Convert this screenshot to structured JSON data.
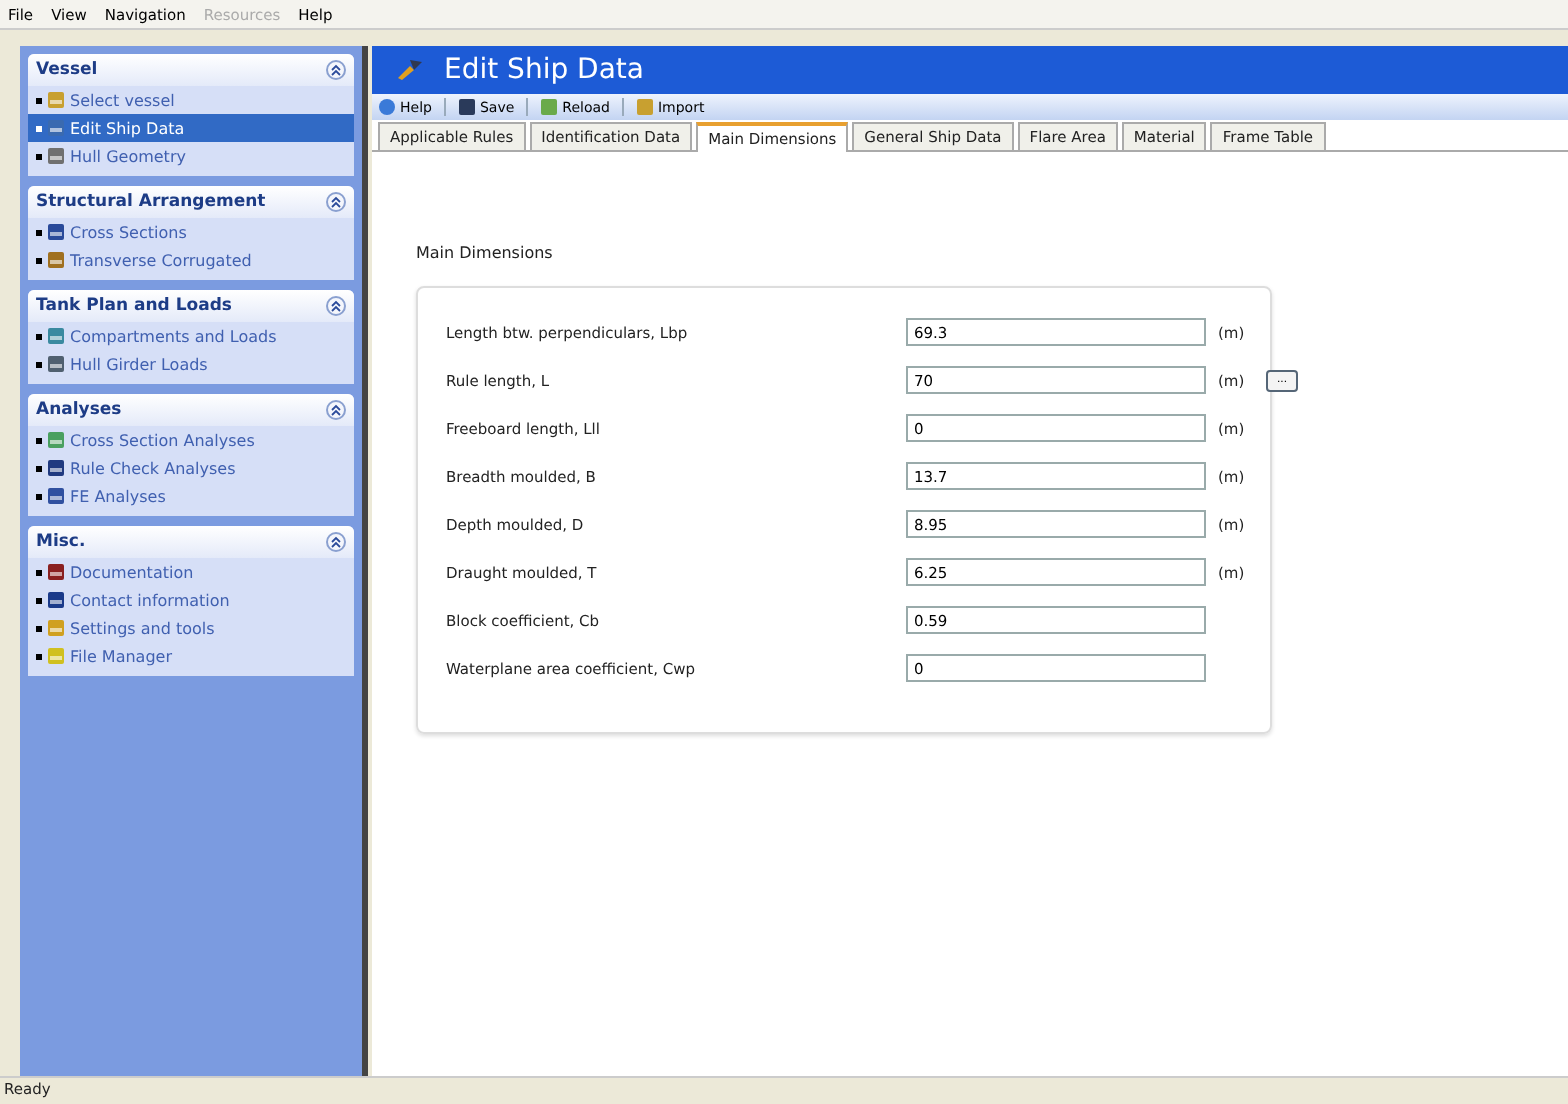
{
  "menu": [
    {
      "label": "File",
      "disabled": false
    },
    {
      "label": "View",
      "disabled": false
    },
    {
      "label": "Navigation",
      "disabled": false
    },
    {
      "label": "Resources",
      "disabled": true
    },
    {
      "label": "Help",
      "disabled": false
    }
  ],
  "sidebar": {
    "groups": [
      {
        "title": "Vessel",
        "expanded": true,
        "items": [
          {
            "label": "Select vessel",
            "selected": false
          },
          {
            "label": "Edit Ship Data",
            "selected": true
          },
          {
            "label": "Hull Geometry",
            "selected": false
          }
        ]
      },
      {
        "title": "Structural Arrangement",
        "expanded": true,
        "items": [
          {
            "label": "Cross Sections",
            "selected": false
          },
          {
            "label": "Transverse Corrugated",
            "selected": false
          }
        ]
      },
      {
        "title": "Tank Plan and Loads",
        "expanded": true,
        "items": [
          {
            "label": "Compartments and Loads",
            "selected": false
          },
          {
            "label": "Hull Girder Loads",
            "selected": false
          }
        ]
      },
      {
        "title": "Analyses",
        "expanded": true,
        "items": [
          {
            "label": "Cross Section Analyses",
            "selected": false
          },
          {
            "label": "Rule Check Analyses",
            "selected": false
          },
          {
            "label": "FE Analyses",
            "selected": false
          }
        ]
      },
      {
        "title": "Misc.",
        "expanded": true,
        "items": [
          {
            "label": "Documentation",
            "selected": false
          },
          {
            "label": "Contact information",
            "selected": false
          },
          {
            "label": "Settings and tools",
            "selected": false
          },
          {
            "label": "File Manager",
            "selected": false
          }
        ]
      }
    ]
  },
  "window": {
    "title": "Edit Ship Data"
  },
  "toolbar": [
    "Help",
    "Save",
    "Reload",
    "Import"
  ],
  "tabs": [
    {
      "label": "Applicable Rules",
      "selected": false
    },
    {
      "label": "Identification Data",
      "selected": false
    },
    {
      "label": "Main Dimensions",
      "selected": true
    },
    {
      "label": "General Ship Data",
      "selected": false
    },
    {
      "label": "Flare Area",
      "selected": false
    },
    {
      "label": "Material",
      "selected": false
    },
    {
      "label": "Frame Table",
      "selected": false
    }
  ],
  "section_title": "Main Dimensions",
  "fields": [
    {
      "label": "Length btw. perpendiculars, Lbp",
      "value": "69.3",
      "unit": "(m)"
    },
    {
      "label": "Rule length, L",
      "value": "70",
      "unit": "(m)",
      "button": "..."
    },
    {
      "label": "Freeboard length, Lll",
      "value": "0",
      "unit": "(m)"
    },
    {
      "label": "Breadth moulded, B",
      "value": "13.7",
      "unit": "(m)"
    },
    {
      "label": "Depth moulded, D",
      "value": "8.95",
      "unit": "(m)"
    },
    {
      "label": "Draught moulded, T",
      "value": "6.25",
      "unit": "(m)"
    },
    {
      "label": "Block coefficient, Cb",
      "value": "0.59"
    },
    {
      "label": "Waterplane area coefficient, Cwp",
      "value": "0"
    }
  ],
  "status_bar": "Ready"
}
